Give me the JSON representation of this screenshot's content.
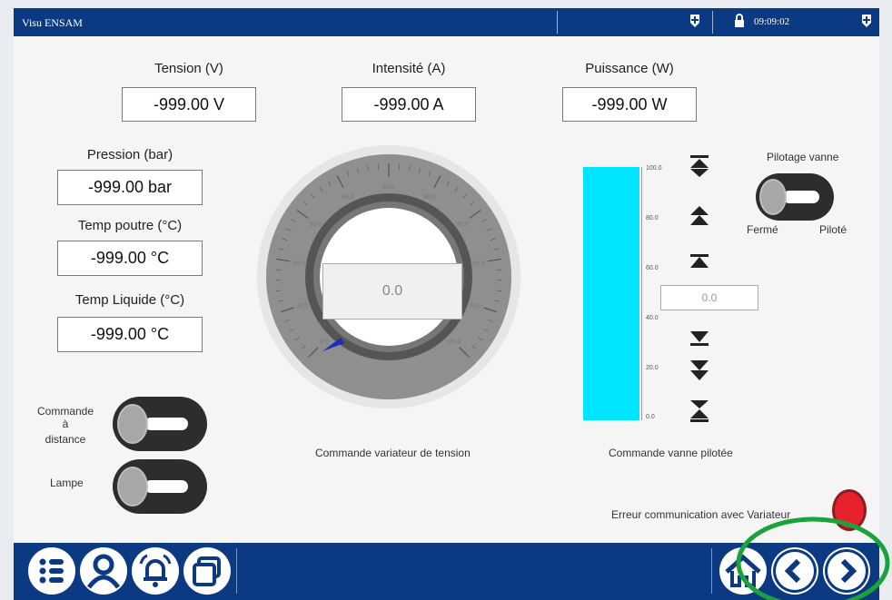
{
  "header": {
    "title": "Visu ENSAM",
    "time": "09:09:02"
  },
  "measures": {
    "tension": {
      "label": "Tension (V)",
      "value": "-999.00 V"
    },
    "intensite": {
      "label": "Intensité (A)",
      "value": "-999.00 A"
    },
    "puissance": {
      "label": "Puissance (W)",
      "value": "-999.00 W"
    },
    "pression": {
      "label": "Pression (bar)",
      "value": "-999.00 bar"
    },
    "temp_poutre": {
      "label": "Temp poutre  (°C)",
      "value": "-999.00 °C"
    },
    "temp_liquide": {
      "label": "Temp Liquide (°C)",
      "value": "-999.00 °C"
    }
  },
  "switches": {
    "commande_distance": {
      "label_line1": "Commande à",
      "label_line2": "distance",
      "state": "off"
    },
    "lampe": {
      "label": "Lampe",
      "state": "off"
    }
  },
  "gauge": {
    "value": "0.0",
    "caption": "Commande variateur de tension",
    "ticks": [
      "0.0",
      "10.0",
      "20.0",
      "30.0",
      "40.0",
      "50.0",
      "60.0",
      "70.0",
      "80.0",
      "90.0",
      "100.0"
    ],
    "needle_value": 0
  },
  "vanne": {
    "caption": "Commande vanne pilotée",
    "value": "0.0",
    "bar_level_percent": 100,
    "scale": [
      "100.0",
      "80.0",
      "60.0",
      "40.0",
      "20.0",
      "0.0"
    ],
    "pilotage_label": "Pilotage vanne",
    "ferme_label": "Fermé",
    "pilote_label": "Piloté"
  },
  "status": {
    "error_text": "Erreur communication avec Variateur",
    "error_color": "#e8212e"
  },
  "nav": {
    "left_icons": [
      "list-icon",
      "user-icon",
      "alarm-bell-icon",
      "windows-icon"
    ],
    "right_icons": [
      "home-icon",
      "back-arrow-icon",
      "forward-arrow-icon"
    ]
  },
  "colors": {
    "header": "#0b3a82",
    "bar_fill": "#00e5ff",
    "highlight_ring": "#1aa33a"
  }
}
